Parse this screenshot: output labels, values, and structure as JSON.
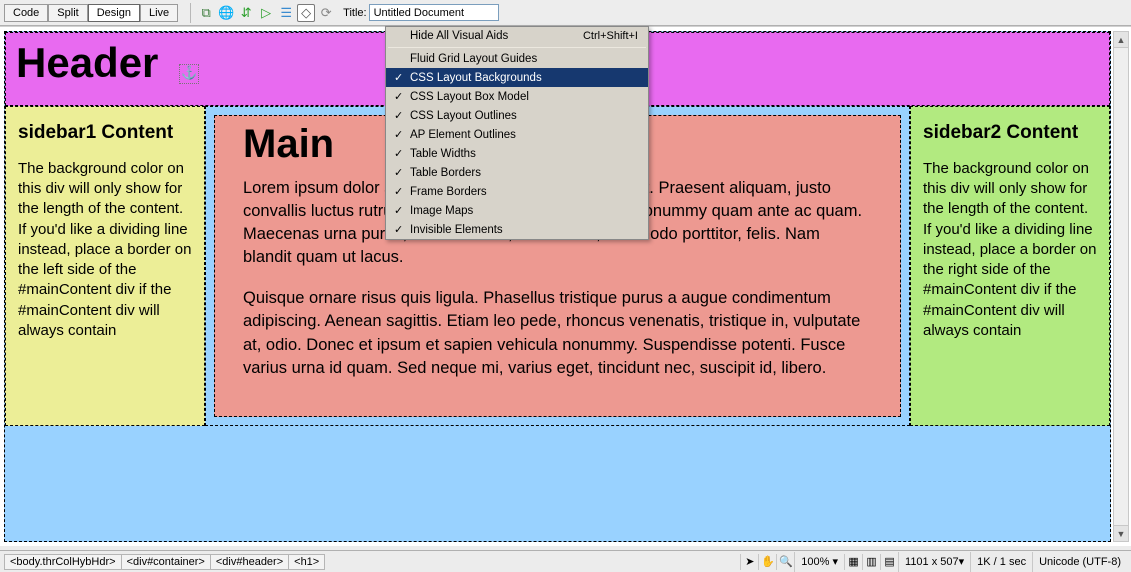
{
  "toolbar": {
    "views": {
      "code": "Code",
      "split": "Split",
      "design": "Design",
      "live": "Live"
    },
    "title_label": "Title:",
    "title_value": "Untitled Document"
  },
  "dropdown": {
    "hide_all": "Hide All Visual Aids",
    "hide_all_shortcut": "Ctrl+Shift+I",
    "items": [
      {
        "label": "Fluid Grid Layout Guides",
        "checked": false
      },
      {
        "label": "CSS Layout Backgrounds",
        "checked": true,
        "selected": true
      },
      {
        "label": "CSS Layout Box Model",
        "checked": true
      },
      {
        "label": "CSS Layout Outlines",
        "checked": true
      },
      {
        "label": "AP Element Outlines",
        "checked": true
      },
      {
        "label": "Table Widths",
        "checked": true
      },
      {
        "label": "Table Borders",
        "checked": true
      },
      {
        "label": "Frame Borders",
        "checked": true
      },
      {
        "label": "Image Maps",
        "checked": true
      },
      {
        "label": "Invisible Elements",
        "checked": true
      }
    ]
  },
  "page": {
    "header_title": "Header",
    "sidebar1": {
      "heading": "sidebar1 Content",
      "body": "The background color on this div will only show for the length of the content. If you'd like a dividing line instead, place a border on the left side of the #mainContent div if the #mainContent div will always contain"
    },
    "main": {
      "heading": "Main",
      "p1": "Lorem ipsum dolor sit amet, consectetuer adipiscing elit. Praesent aliquam, justo convallis luctus rutrum, erat nulla fermentum diam, at nonummy quam ante ac quam. Maecenas urna purus, fermentum id, molestie in, commodo porttitor, felis. Nam blandit quam ut lacus.",
      "p2": "Quisque ornare risus quis ligula. Phasellus tristique purus a augue condimentum adipiscing. Aenean sagittis. Etiam leo pede, rhoncus venenatis, tristique in, vulputate at, odio. Donec et ipsum et sapien vehicula nonummy. Suspendisse potenti. Fusce varius urna id quam. Sed neque mi, varius eget, tincidunt nec, suscipit id, libero."
    },
    "sidebar2": {
      "heading": "sidebar2 Content",
      "body": "The background color on this div will only show for the length of the content. If you'd like a dividing line instead, place a border on the right side of the #mainContent div if the #mainContent div will always contain"
    }
  },
  "status": {
    "tags": [
      "<body.thrColHybHdr>",
      "<div#container>",
      "<div#header>",
      "<h1>"
    ],
    "zoom": "100%",
    "dims": "1101 x 507",
    "size": "1K / 1 sec",
    "encoding": "Unicode (UTF-8)"
  }
}
